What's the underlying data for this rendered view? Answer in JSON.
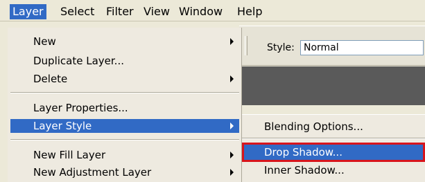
{
  "menubar": {
    "items": [
      "Layer",
      "Select",
      "Filter",
      "View",
      "Window",
      "Help"
    ],
    "active_index": 0
  },
  "options_bar": {
    "style_label": "Style:",
    "style_value": "Normal"
  },
  "layer_menu": {
    "items": [
      {
        "label": "New",
        "has_submenu": true
      },
      {
        "label": "Duplicate Layer...",
        "has_submenu": false
      },
      {
        "label": "Delete",
        "has_submenu": true
      },
      {
        "label": "Layer Properties...",
        "has_submenu": false
      },
      {
        "label": "Layer Style",
        "has_submenu": true,
        "active": true
      },
      {
        "label": "New Fill Layer",
        "has_submenu": true
      },
      {
        "label": "New Adjustment Layer",
        "has_submenu": true
      }
    ]
  },
  "layer_style_submenu": {
    "items": [
      {
        "label": "Blending Options..."
      },
      {
        "label": "Drop Shadow...",
        "active": true,
        "outlined": true
      },
      {
        "label": "Inner Shadow..."
      }
    ],
    "outline_color": "#d8151c"
  },
  "colors": {
    "accent": "#316ac5",
    "menu_bg": "#eeeae0",
    "highlight_outline": "#d8151c"
  }
}
